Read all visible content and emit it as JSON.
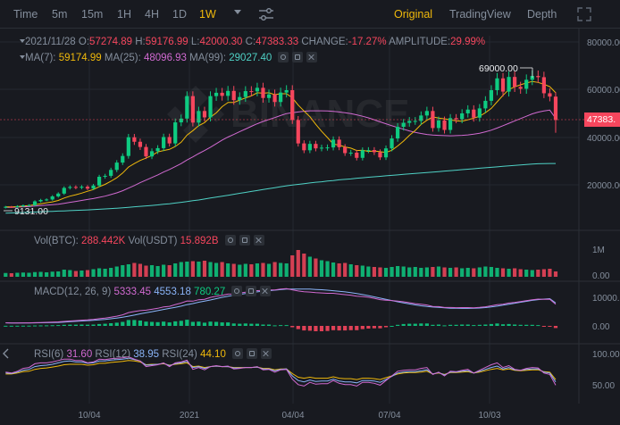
{
  "toolbar": {
    "timeframes": [
      "Time",
      "5m",
      "15m",
      "1H",
      "4H",
      "1D",
      "1W"
    ],
    "active_timeframe": "1W",
    "views": [
      "Original",
      "TradingView",
      "Depth"
    ],
    "active_view": "Original",
    "icons": [
      "chevron-down-icon",
      "sliders-icon",
      "expand-icon"
    ]
  },
  "ohlc": {
    "date": "2021/11/28",
    "o_label": "O:",
    "o": "57274.89",
    "h_label": "H:",
    "h": "59176.99",
    "l_label": "L:",
    "l": "42000.30",
    "c_label": "C:",
    "c": "47383.33",
    "change_label": "CHANGE:",
    "change": "-17.27%",
    "amp_label": "AMPLITUDE:",
    "amp": "29.99%"
  },
  "ma": {
    "ma7_label": "MA(7):",
    "ma7": "59174.99",
    "ma25_label": "MA(25):",
    "ma25": "48096.93",
    "ma99_label": "MA(99):",
    "ma99": "29027.40"
  },
  "annotations": {
    "high": "69000.00",
    "low": "9131.00",
    "last_price": "47383."
  },
  "vol": {
    "label": "Vol(BTC):",
    "btc": "288.442K",
    "usdt_label": "Vol(USDT)",
    "usdt": "15.892B"
  },
  "macd": {
    "label": "MACD(12, 26, 9)",
    "dif": "5333.45",
    "dea": "4553.18",
    "hist": "780.27"
  },
  "rsi": {
    "rsi6_label": "RSI(6)",
    "rsi6": "31.60",
    "rsi12_label": "RSI(12)",
    "rsi12": "38.95",
    "rsi24_label": "RSI(24)",
    "rsi24": "44.10"
  },
  "axis": {
    "price": [
      "80000.00",
      "60000.00",
      "40000.00",
      "20000.00"
    ],
    "vol": [
      "1M",
      "0.00"
    ],
    "macd": [
      "10000.00",
      "0.00"
    ],
    "rsi": [
      "100.00",
      "50.00"
    ],
    "time": [
      "10/04",
      "2021",
      "04/04",
      "07/04",
      "10/03"
    ]
  },
  "colors": {
    "up": "#0ecb81",
    "down": "#f6465d",
    "accent": "#f0b90b",
    "ma7": "#f0b90b",
    "ma25": "#d16ad1",
    "ma99": "#4fd1c5",
    "rsi6": "#d16ad1",
    "rsi12": "#8ab4f8",
    "rsi24": "#f0b90b"
  },
  "chart_data": {
    "type": "candlestick",
    "closes": [
      10700,
      10600,
      11000,
      11300,
      11400,
      13000,
      13600,
      13800,
      15100,
      16300,
      18700,
      19100,
      18800,
      19200,
      18400,
      19700,
      23400,
      23800,
      26300,
      29400,
      32200,
      40100,
      38200,
      36000,
      32000,
      34200,
      35500,
      40200,
      37500,
      46400,
      48000,
      57500,
      46300,
      51200,
      48500,
      57500,
      58900,
      57600,
      59700,
      55800,
      57100,
      59600,
      59500,
      61000,
      56700,
      58200,
      55000,
      59000,
      60000,
      47400,
      37500,
      34600,
      37300,
      35400,
      35700,
      35800,
      39100,
      35900,
      33400,
      33600,
      31400,
      34600,
      34700,
      33800,
      31600,
      35400,
      39600,
      44500,
      46200,
      47000,
      47000,
      49300,
      51200,
      44000,
      47200,
      43200,
      48200,
      47700,
      50200,
      51800,
      48400,
      52300,
      55500,
      60000,
      65000,
      59400,
      65600,
      61400,
      60600,
      64400,
      66000,
      65500,
      58700,
      57300,
      47383
    ],
    "ma7": [
      10700,
      10650,
      10800,
      11000,
      11200,
      11600,
      12000,
      12400,
      12800,
      13400,
      14400,
      15200,
      15800,
      16500,
      17300,
      18000,
      19200,
      20200,
      21500,
      23000,
      25000,
      27500,
      29000,
      30300,
      31300,
      32400,
      33900,
      34500,
      35000,
      36200,
      38000,
      41000,
      42900,
      45000,
      46300,
      48600,
      50400,
      53000,
      54800,
      54800,
      55800,
      56700,
      57600,
      58900,
      58700,
      58900,
      58100,
      58500,
      58500,
      56800,
      53700,
      51200,
      48800,
      45600,
      42600,
      40000,
      37200,
      36800,
      36000,
      35500,
      34500,
      34600,
      34100,
      34300,
      34000,
      33700,
      34600,
      36400,
      38500,
      40900,
      43000,
      45500,
      47300,
      48700,
      48200,
      47900,
      47500,
      47000,
      46900,
      47500,
      48200,
      49000,
      50500,
      52300,
      55100,
      57800,
      60300,
      61400,
      62300,
      63000,
      63700,
      63300,
      62500,
      61500,
      58900
    ],
    "ma25": [
      10500,
      10500,
      10600,
      10700,
      10800,
      11000,
      11200,
      11400,
      11600,
      11800,
      12200,
      12600,
      13000,
      13400,
      13800,
      14200,
      14700,
      15200,
      15900,
      16600,
      17500,
      18600,
      19700,
      20900,
      22000,
      23100,
      24200,
      25400,
      26500,
      27700,
      29000,
      30500,
      31800,
      33200,
      34500,
      35900,
      37400,
      38900,
      40200,
      41300,
      42500,
      43600,
      44700,
      45800,
      46800,
      47600,
      48400,
      49300,
      50100,
      50500,
      50800,
      51100,
      51300,
      51300,
      51300,
      51200,
      51000,
      50800,
      50500,
      50100,
      49600,
      49000,
      48300,
      47500,
      46600,
      45800,
      45000,
      44200,
      43500,
      42800,
      42200,
      41700,
      41300,
      41000,
      40900,
      40800,
      40700,
      40800,
      40900,
      41100,
      41400,
      41800,
      42400,
      43100,
      44000,
      45000,
      46000,
      47000,
      48000,
      49000,
      50000,
      50700,
      51200,
      51600,
      48096
    ],
    "ma99": [
      8000,
      8100,
      8200,
      8300,
      8400,
      8500,
      8600,
      8700,
      8800,
      8900,
      9000,
      9100,
      9200,
      9300,
      9400,
      9500,
      9650,
      9800,
      9950,
      10100,
      10300,
      10500,
      10700,
      10900,
      11100,
      11300,
      11500,
      11800,
      12000,
      12300,
      12600,
      12900,
      13300,
      13600,
      14000,
      14400,
      14800,
      15200,
      15600,
      16000,
      16400,
      16800,
      17200,
      17600,
      18000,
      18400,
      18800,
      19200,
      19600,
      19900,
      20200,
      20500,
      20800,
      21100,
      21300,
      21600,
      21800,
      22100,
      22300,
      22500,
      22800,
      23000,
      23200,
      23400,
      23600,
      23800,
      24000,
      24200,
      24400,
      24600,
      24800,
      25000,
      25200,
      25400,
      25600,
      25800,
      26000,
      26200,
      26400,
      26600,
      26800,
      27000,
      27200,
      27400,
      27600,
      27800,
      28000,
      28200,
      28400,
      28600,
      28800,
      28900,
      29000,
      29027,
      29027
    ],
    "volume": [
      85,
      80,
      90,
      95,
      90,
      105,
      110,
      100,
      115,
      120,
      160,
      150,
      130,
      140,
      150,
      170,
      190,
      180,
      200,
      230,
      260,
      280,
      310,
      290,
      250,
      260,
      240,
      270,
      260,
      300,
      330,
      340,
      350,
      340,
      360,
      330,
      310,
      330,
      300,
      290,
      270,
      290,
      280,
      300,
      310,
      290,
      330,
      310,
      300,
      480,
      600,
      520,
      450,
      410,
      370,
      350,
      320,
      300,
      310,
      280,
      260,
      250,
      230,
      220,
      210,
      200,
      220,
      240,
      230,
      210,
      220,
      200,
      210,
      220,
      230,
      210,
      200,
      210,
      190,
      200,
      190,
      210,
      230,
      220,
      200,
      190,
      180,
      190,
      170,
      160,
      150,
      160,
      170,
      180,
      120
    ],
    "macd_hist": [
      50,
      50,
      60,
      80,
      90,
      150,
      180,
      200,
      250,
      300,
      400,
      450,
      450,
      500,
      450,
      500,
      700,
      800,
      1000,
      1200,
      1500,
      2200,
      2200,
      2000,
      1600,
      1500,
      1400,
      1600,
      1300,
      1700,
      1900,
      2300,
      1500,
      1600,
      1200,
      1600,
      1500,
      1300,
      1300,
      900,
      800,
      900,
      800,
      800,
      500,
      500,
      200,
      300,
      300,
      -500,
      -1200,
      -1700,
      -1800,
      -2000,
      -2000,
      -1900,
      -1600,
      -1700,
      -1700,
      -1600,
      -1600,
      -1200,
      -1000,
      -900,
      -900,
      -500,
      0,
      400,
      700,
      800,
      800,
      900,
      900,
      400,
      500,
      200,
      400,
      400,
      500,
      500,
      300,
      400,
      500,
      700,
      900,
      600,
      700,
      500,
      400,
      400,
      400,
      300,
      -100,
      -300,
      -800
    ],
    "rsi6": [
      60,
      58,
      62,
      68,
      70,
      78,
      80,
      80,
      82,
      85,
      88,
      88,
      85,
      85,
      80,
      82,
      88,
      87,
      89,
      90,
      91,
      93,
      88,
      84,
      72,
      74,
      76,
      80,
      72,
      80,
      82,
      86,
      66,
      70,
      65,
      72,
      74,
      72,
      73,
      67,
      68,
      70,
      70,
      72,
      65,
      66,
      60,
      65,
      66,
      45,
      33,
      30,
      38,
      34,
      35,
      35,
      42,
      36,
      33,
      33,
      30,
      38,
      38,
      36,
      32,
      42,
      52,
      62,
      64,
      65,
      65,
      68,
      70,
      55,
      60,
      52,
      62,
      61,
      64,
      66,
      58,
      64,
      70,
      76,
      80,
      70,
      74,
      66,
      64,
      68,
      70,
      69,
      58,
      55,
      32
    ],
    "rsi12": [
      58,
      57,
      60,
      64,
      66,
      72,
      74,
      75,
      77,
      80,
      83,
      84,
      82,
      82,
      79,
      80,
      84,
      84,
      86,
      87,
      88,
      90,
      87,
      84,
      75,
      76,
      77,
      79,
      74,
      78,
      80,
      83,
      70,
      72,
      68,
      72,
      73,
      72,
      72,
      69,
      69,
      70,
      70,
      71,
      67,
      67,
      63,
      66,
      67,
      52,
      42,
      39,
      43,
      40,
      41,
      41,
      45,
      41,
      39,
      39,
      37,
      42,
      42,
      41,
      38,
      44,
      51,
      58,
      60,
      61,
      61,
      63,
      65,
      56,
      59,
      54,
      60,
      60,
      62,
      63,
      58,
      62,
      66,
      70,
      73,
      67,
      70,
      65,
      64,
      66,
      67,
      67,
      60,
      58,
      39
    ],
    "rsi24": [
      56,
      56,
      58,
      61,
      62,
      66,
      68,
      69,
      71,
      73,
      76,
      77,
      77,
      77,
      75,
      76,
      79,
      79,
      81,
      82,
      83,
      85,
      84,
      82,
      76,
      77,
      77,
      78,
      75,
      77,
      78,
      80,
      72,
      73,
      70,
      72,
      73,
      72,
      72,
      70,
      70,
      70,
      70,
      71,
      68,
      68,
      65,
      67,
      67,
      57,
      49,
      47,
      49,
      47,
      47,
      47,
      50,
      47,
      46,
      46,
      44,
      47,
      47,
      46,
      44,
      48,
      52,
      56,
      58,
      59,
      59,
      60,
      62,
      56,
      58,
      55,
      59,
      59,
      60,
      61,
      58,
      60,
      63,
      66,
      68,
      65,
      67,
      64,
      63,
      64,
      65,
      65,
      61,
      60,
      44
    ]
  }
}
